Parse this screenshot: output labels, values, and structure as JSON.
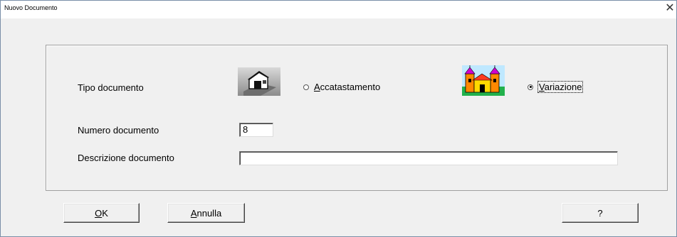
{
  "window": {
    "title": "Nuovo Documento",
    "close_glyph": "✕"
  },
  "form": {
    "tipo_label": "Tipo documento",
    "radio_accatastamento": {
      "label": "Accatastamento",
      "checked": false,
      "icon": "house-icon"
    },
    "radio_variazione": {
      "label": "Variazione",
      "checked": true,
      "icon": "castle-icon"
    },
    "numero_label": "Numero documento",
    "numero_value": "8",
    "descrizione_label": "Descrizione documento",
    "descrizione_value": ""
  },
  "buttons": {
    "ok": "OK",
    "annulla": "Annulla",
    "help": "?"
  }
}
